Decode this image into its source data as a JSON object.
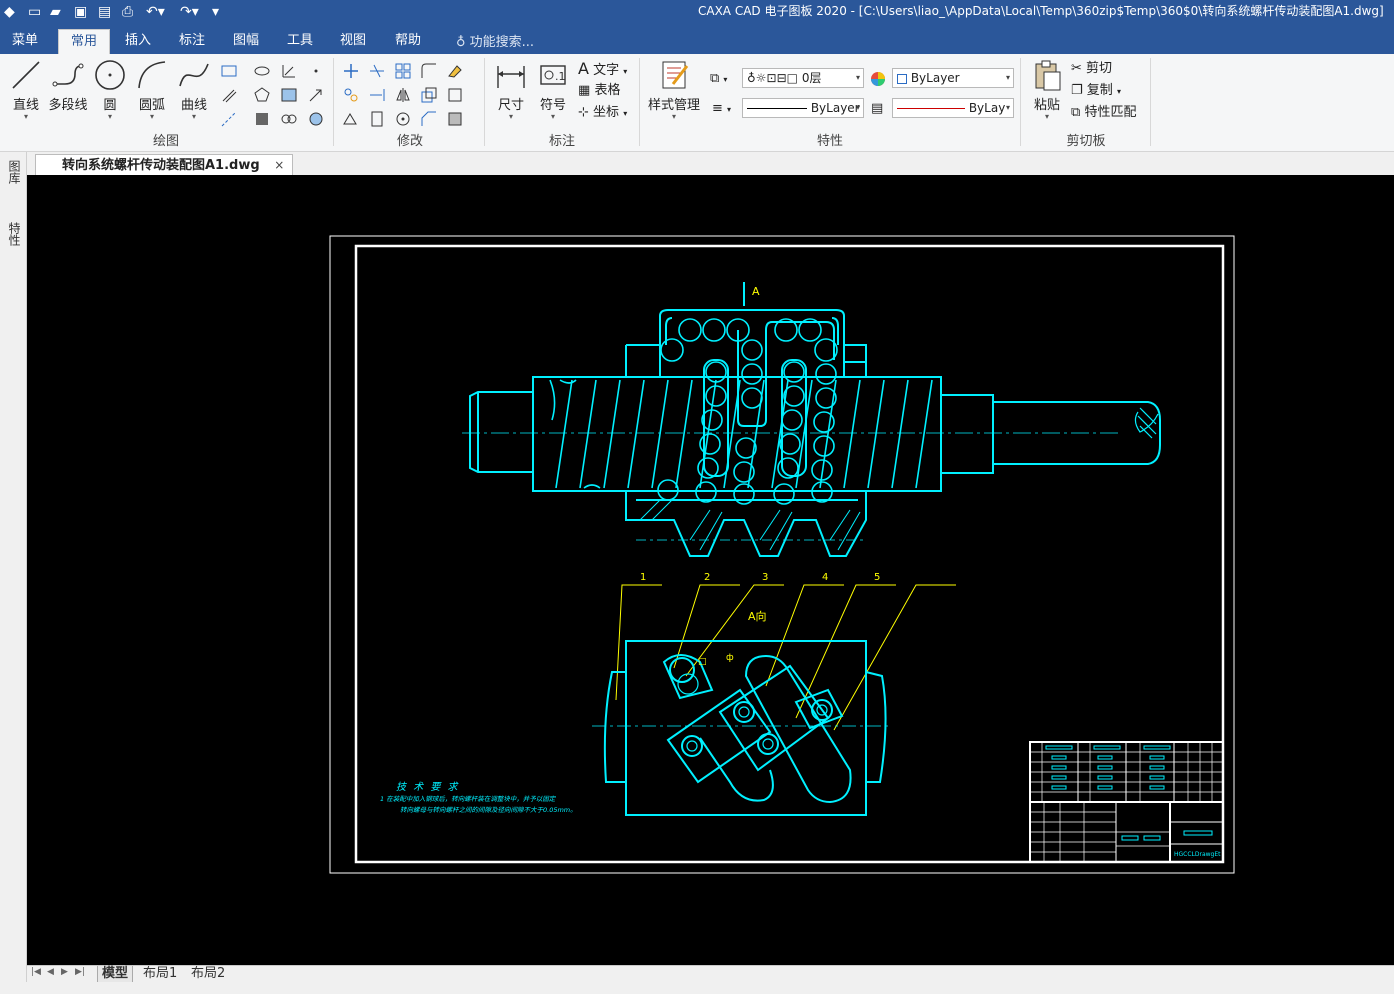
{
  "app": {
    "title": "CAXA CAD 电子图板 2020 - [C:\\Users\\liao_\\AppData\\Local\\Temp\\360zip$Temp\\360$0\\转向系统螺杆传动装配图A1.dwg]"
  },
  "menu_tabs": [
    {
      "label": "菜单"
    },
    {
      "label": "常用",
      "active": true
    },
    {
      "label": "插入"
    },
    {
      "label": "标注"
    },
    {
      "label": "图幅"
    },
    {
      "label": "工具"
    },
    {
      "label": "视图"
    },
    {
      "label": "帮助"
    }
  ],
  "search": {
    "label": "功能搜索..."
  },
  "ribbon": {
    "draw": {
      "group": "绘图",
      "line": "直线",
      "polyline": "多段线",
      "circle": "圆",
      "arc": "圆弧",
      "curve": "曲线"
    },
    "modify": {
      "group": "修改"
    },
    "annotate": {
      "group": "标注",
      "dimension": "尺寸",
      "symbol": "符号",
      "text": "文字",
      "table": "表格",
      "coordinate": "坐标"
    },
    "properties": {
      "group": "特性",
      "style_manager": "样式管理",
      "layer": "0层",
      "color": "ByLayer",
      "linetype": "ByLayer",
      "lineweight": "ByLay"
    },
    "clipboard": {
      "group": "剪切板",
      "paste": "粘贴",
      "cut": "剪切",
      "copy": "复制",
      "match": "特性匹配"
    }
  },
  "document": {
    "tab_label": "转向系统螺杆传动装配图A1.dwg",
    "close": "×"
  },
  "side_panels": [
    "图库",
    "特性"
  ],
  "layouts": [
    {
      "label": "模型",
      "active": true
    },
    {
      "label": "布局1"
    },
    {
      "label": "布局2"
    }
  ],
  "drawing": {
    "view_label_a": "A",
    "view_label_a_dir": "A向",
    "balloons": [
      "1",
      "2",
      "3",
      "4",
      "5"
    ],
    "tech_req_title": "技 术 要 求",
    "tech_req_line1": "1  在装配中加入钢球后，转向螺杆装在调整块中，并予以固定",
    "tech_req_line2": "转向螺母与转向螺杆之间的间隙及径向间隙不大于0.05mm。",
    "title_block_code": "HGCCLDrawgEt"
  },
  "colors": {
    "ribbon_blue": "#2b579a",
    "drawing_cyan": "#00f0ff",
    "drawing_yellow": "#ffff00",
    "canvas_bg": "#000000",
    "frame_white": "#ffffff"
  }
}
